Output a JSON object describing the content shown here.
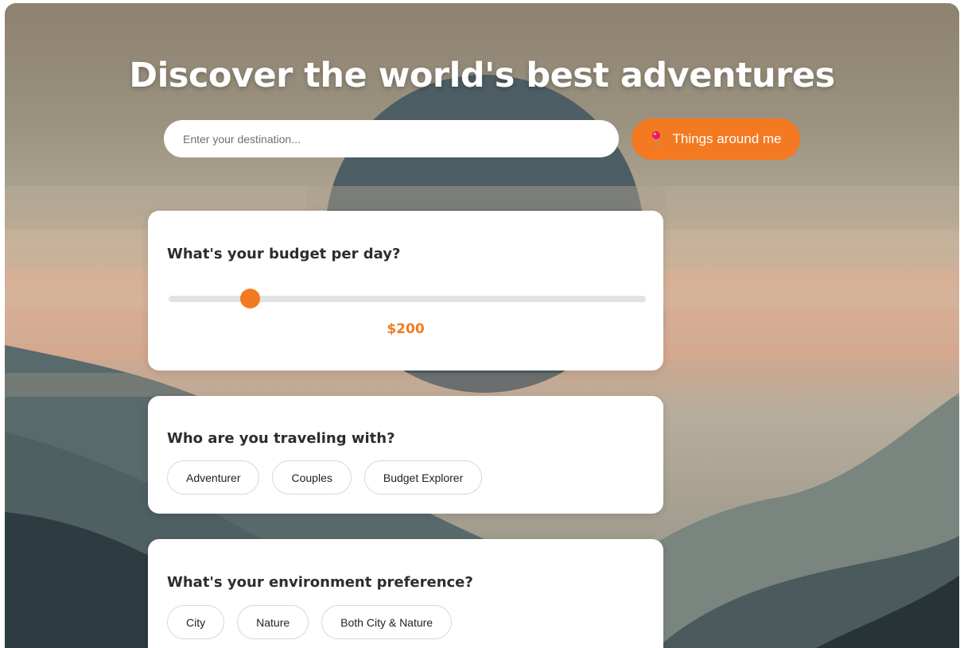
{
  "hero": {
    "title": "Discover the world's best adventures"
  },
  "search": {
    "placeholder": "Enter your destination...",
    "value": ""
  },
  "near_button": {
    "label": "Things around me",
    "icon": "pushpin-icon"
  },
  "budget": {
    "question": "What's your budget per day?",
    "value_label": "$200",
    "level": 0.17
  },
  "companions": {
    "question": "Who are you traveling with?",
    "options": [
      "Adventurer",
      "Couples",
      "Budget Explorer"
    ]
  },
  "environment": {
    "question": "What's your environment preference?",
    "options": [
      "City",
      "Nature",
      "Both City & Nature"
    ]
  },
  "colors": {
    "accent": "#f37a21",
    "card": "#ffffff",
    "heading_text": "#2d2d2d"
  }
}
